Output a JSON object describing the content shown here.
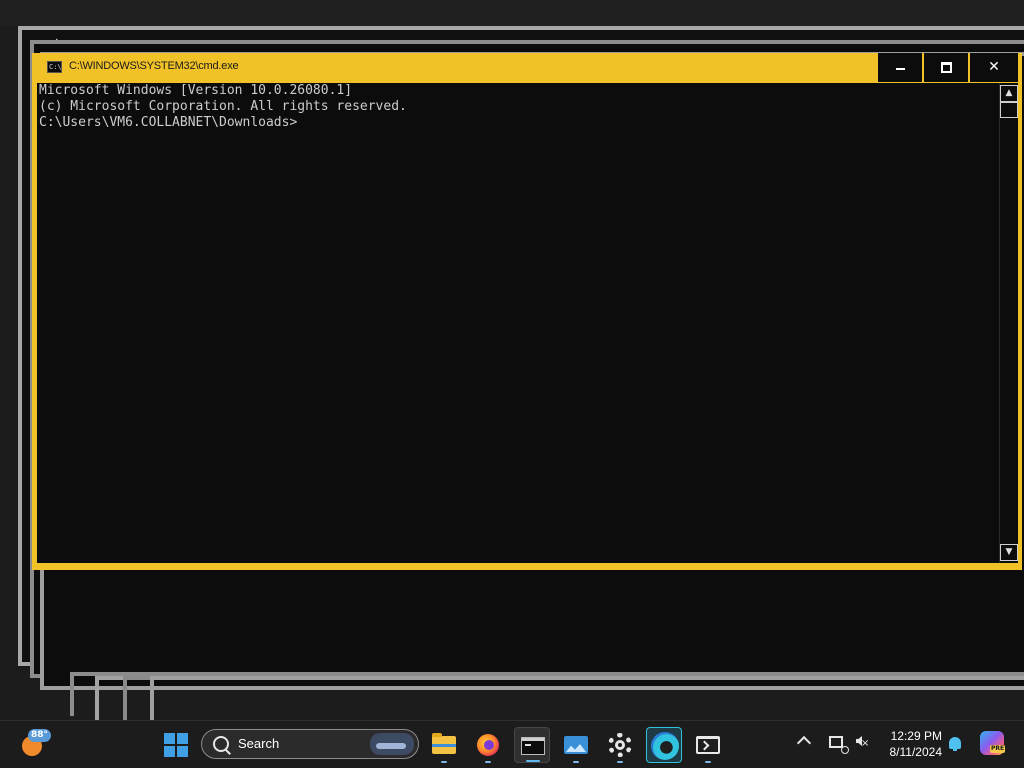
{
  "window": {
    "title": "C:\\WINDOWS\\SYSTEM32\\cmd.exe",
    "minimize_label": "—",
    "maximize_label": "☐",
    "close_label": "✕",
    "frame_color": "#f1c227",
    "console_bg": "#0c0c0c"
  },
  "console": {
    "lines": [
      "Microsoft Windows [Version 10.0.26080.1]",
      "(c) Microsoft Corporation. All rights reserved.",
      "",
      "C:\\Users\\VM6.COLLABNET\\Downloads>"
    ]
  },
  "background_window": {
    "new_tab_label": "+",
    "dropdown_label": "⌄"
  },
  "taskbar": {
    "weather_temp": "88°",
    "search_label": "Search",
    "apps": [
      {
        "name": "File Explorer",
        "icon": "folder-icon",
        "active": false
      },
      {
        "name": "Firefox",
        "icon": "firefox-icon",
        "active": false
      },
      {
        "name": "Command Prompt",
        "icon": "cmd-icon",
        "active": true
      },
      {
        "name": "Photos",
        "icon": "photos-icon",
        "active": false
      },
      {
        "name": "Settings",
        "icon": "gear-icon",
        "active": false
      },
      {
        "name": "Microsoft Edge",
        "icon": "edge-icon",
        "active": false
      },
      {
        "name": "Terminal",
        "icon": "terminal-icon",
        "active": false
      }
    ],
    "clock_time": "12:29 PM",
    "clock_date": "8/11/2024",
    "copilot_badge": "PRE"
  }
}
